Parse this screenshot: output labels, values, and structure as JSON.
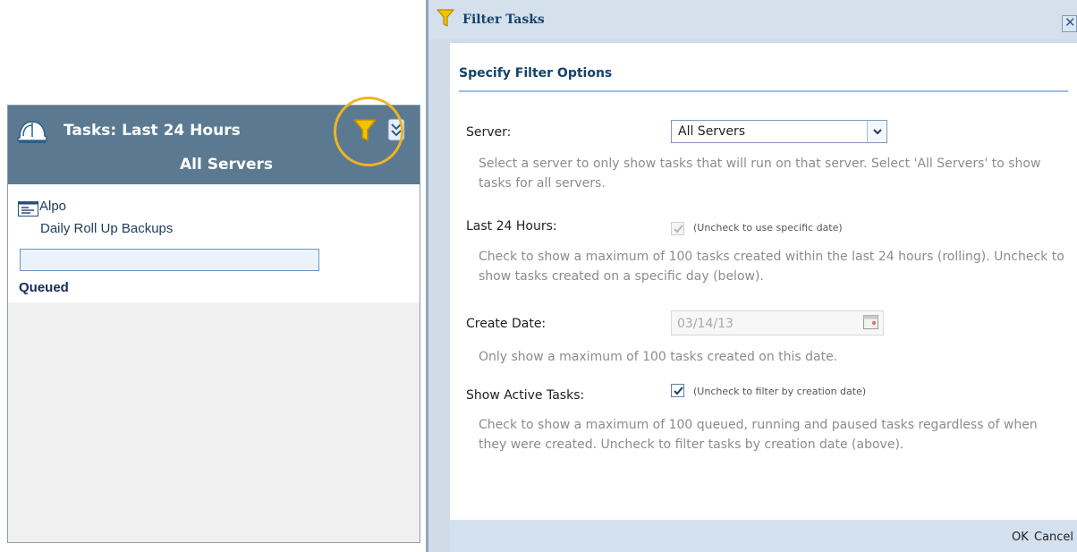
{
  "tasks_panel": {
    "title": "Tasks: Last 24 Hours",
    "subtitle": "All Servers",
    "header_icon": "helmet-icon",
    "filter_icon": "filter-funnel-icon",
    "collapse_icon": "chevron-down-icon",
    "highlight_color": "#f0b323",
    "tasks": [
      {
        "server": "Alpo",
        "name": "Daily Roll Up Backups",
        "progress": 0,
        "status": "Queued"
      }
    ]
  },
  "filter_dialog": {
    "title": "Filter Tasks",
    "title_icon": "filter-funnel-icon",
    "close_icon": "close-icon",
    "heading": "Specify Filter Options",
    "server": {
      "label": "Server:",
      "selected": "All Servers",
      "help": "Select a server to only show tasks that will run on that server. Select 'All Servers' to show tasks for all servers."
    },
    "last_24_hours": {
      "label": "Last 24 Hours:",
      "checked": true,
      "disabled": true,
      "note": "(Uncheck to use specific date)",
      "help": "Check to show a maximum of 100 tasks created within the last 24 hours (rolling). Uncheck to show tasks created on a specific day (below)."
    },
    "create_date": {
      "label": "Create Date:",
      "value": "03/14/13",
      "picker_icon": "calendar-icon",
      "help": "Only show a maximum of 100 tasks created on this date."
    },
    "show_active_tasks": {
      "label": "Show Active Tasks:",
      "checked": true,
      "note": "(Uncheck to filter by creation date)",
      "help": "Check to show a maximum of 100 queued, running and paused tasks regardless of when they were created. Uncheck to filter tasks by creation date (above)."
    },
    "ok_label": "OK",
    "cancel_label": "Cancel"
  },
  "colors": {
    "panel_header": "#5b7a91",
    "dialog_frame": "#cfdce8",
    "dialog_accent": "#15426d",
    "help_text": "#8c8c8c"
  }
}
